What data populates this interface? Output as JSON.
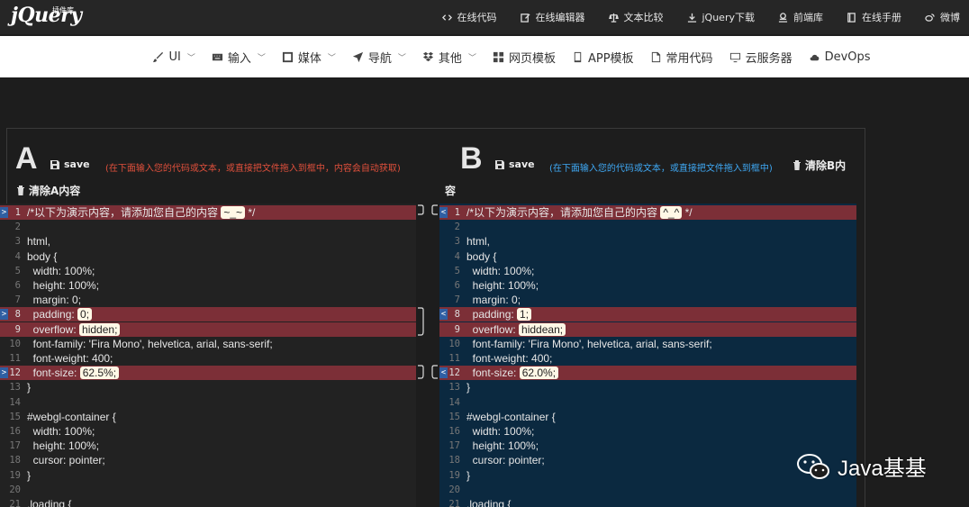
{
  "header": {
    "logo": "jQuery",
    "logo_sub": "插件库",
    "nav": [
      {
        "label": "在线代码",
        "icon": "code-icon"
      },
      {
        "label": "在线编辑器",
        "icon": "edit-icon"
      },
      {
        "label": "文本比较",
        "icon": "scale-icon"
      },
      {
        "label": "jQuery下载",
        "icon": "download-icon"
      },
      {
        "label": "前端库",
        "icon": "library-icon"
      },
      {
        "label": "在线手册",
        "icon": "book-icon"
      },
      {
        "label": "微博",
        "icon": "weibo-icon"
      }
    ]
  },
  "subnav": [
    {
      "label": "UI",
      "icon": "brush-icon",
      "dropdown": true
    },
    {
      "label": "输入",
      "icon": "keyboard-icon",
      "dropdown": true
    },
    {
      "label": "媒体",
      "icon": "film-icon",
      "dropdown": true
    },
    {
      "label": "导航",
      "icon": "send-icon",
      "dropdown": true
    },
    {
      "label": "其他",
      "icon": "dropbox-icon",
      "dropdown": true
    },
    {
      "label": "网页模板",
      "icon": "grid-icon",
      "dropdown": false
    },
    {
      "label": "APP模板",
      "icon": "mobile-icon",
      "dropdown": false
    },
    {
      "label": "常用代码",
      "icon": "file-icon",
      "dropdown": false
    },
    {
      "label": "云服务器",
      "icon": "monitor-icon",
      "dropdown": false
    },
    {
      "label": "DevOps",
      "icon": "cloud-icon",
      "dropdown": false
    }
  ],
  "side_a": {
    "letter": "A",
    "save": "save",
    "hint": "(在下面输入您的代码或文本，或直接把文件拖入到框中，内容会自动获取)",
    "clear": "清除A内容"
  },
  "side_b": {
    "letter": "B",
    "save": "save",
    "hint": "(在下面输入您的代码或文本，或直接把文件拖入到框中)",
    "clear": "清除B内",
    "clear_wrap": "容"
  },
  "editor_a": [
    {
      "n": "1",
      "pre": "/*以下为演示内容，请添加您自己的内容 ",
      "hl": "~_~",
      "post": " */",
      "diff": true,
      "marker": ">"
    },
    {
      "n": "2",
      "text": ""
    },
    {
      "n": "3",
      "text": "html,"
    },
    {
      "n": "4",
      "text": "body {"
    },
    {
      "n": "5",
      "text": "  width: 100%;"
    },
    {
      "n": "6",
      "text": "  height: 100%;"
    },
    {
      "n": "7",
      "text": "  margin: 0;"
    },
    {
      "n": "8",
      "pre": "  padding: ",
      "hl": "0;",
      "post": "",
      "diff": true,
      "marker": ">"
    },
    {
      "n": "9",
      "pre": "  overflow: ",
      "hl": "hidden;",
      "post": "",
      "diff": true
    },
    {
      "n": "10",
      "text": "  font-family: 'Fira Mono', helvetica, arial, sans-serif;"
    },
    {
      "n": "11",
      "text": "  font-weight: 400;"
    },
    {
      "n": "12",
      "pre": "  font-size: ",
      "hl": "62.5%;",
      "post": "",
      "diff": true,
      "marker": ">"
    },
    {
      "n": "13",
      "text": "}"
    },
    {
      "n": "14",
      "text": ""
    },
    {
      "n": "15",
      "text": "#webgl-container {"
    },
    {
      "n": "16",
      "text": "  width: 100%;"
    },
    {
      "n": "17",
      "text": "  height: 100%;"
    },
    {
      "n": "18",
      "text": "  cursor: pointer;"
    },
    {
      "n": "19",
      "text": "}"
    },
    {
      "n": "20",
      "text": ""
    },
    {
      "n": "21",
      "text": ".loading {"
    }
  ],
  "editor_b": [
    {
      "n": "1",
      "pre": "/*以下为演示内容，请添加您自己的内容 ",
      "hl": "^_^",
      "post": " */",
      "diff": true,
      "marker": "<"
    },
    {
      "n": "2",
      "text": ""
    },
    {
      "n": "3",
      "text": "html,"
    },
    {
      "n": "4",
      "text": "body {"
    },
    {
      "n": "5",
      "text": "  width: 100%;"
    },
    {
      "n": "6",
      "text": "  height: 100%;"
    },
    {
      "n": "7",
      "text": "  margin: 0;"
    },
    {
      "n": "8",
      "pre": "  padding: ",
      "hl": "1;",
      "post": "",
      "diff": true,
      "marker": "<"
    },
    {
      "n": "9",
      "pre": "  overflow: ",
      "hl": "hiddean;",
      "post": "",
      "diff": true
    },
    {
      "n": "10",
      "text": "  font-family: 'Fira Mono', helvetica, arial, sans-serif;"
    },
    {
      "n": "11",
      "text": "  font-weight: 400;"
    },
    {
      "n": "12",
      "pre": "  font-size: ",
      "hl": "62.0%;",
      "post": "",
      "diff": true,
      "marker": "<"
    },
    {
      "n": "13",
      "text": "}"
    },
    {
      "n": "14",
      "text": ""
    },
    {
      "n": "15",
      "text": "#webgl-container {"
    },
    {
      "n": "16",
      "text": "  width: 100%;"
    },
    {
      "n": "17",
      "text": "  height: 100%;"
    },
    {
      "n": "18",
      "text": "  cursor: pointer;"
    },
    {
      "n": "19",
      "text": "}"
    },
    {
      "n": "20",
      "text": ""
    },
    {
      "n": "21",
      "text": ".loading {"
    }
  ],
  "watermark": "Java基基",
  "colors": {
    "diff_bg": "#7c2f37",
    "editor_b_bg": "#0b2940",
    "hint_a": "#e0503c",
    "hint_b": "#3fa9f5"
  }
}
